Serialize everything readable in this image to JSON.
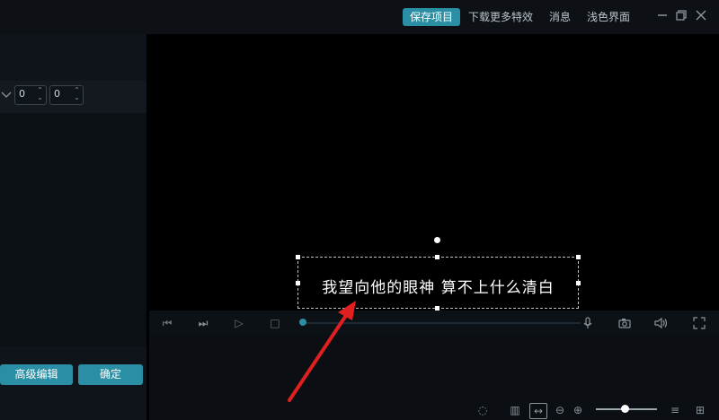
{
  "topbar": {
    "save_project": "保存项目",
    "download_effects": "下载更多特效",
    "messages": "消息",
    "light_theme": "浅色界面"
  },
  "left_panel": {
    "spinner_values": [
      "0",
      "0"
    ],
    "advanced_edit_label": "高级编辑",
    "confirm_label": "确定"
  },
  "preview": {
    "caption_text": "我望向他的眼神 算不上什么清白"
  },
  "zoom": {
    "level": 0.45
  },
  "colors": {
    "accent": "#2a8fa4",
    "arrow": "#e02020"
  }
}
